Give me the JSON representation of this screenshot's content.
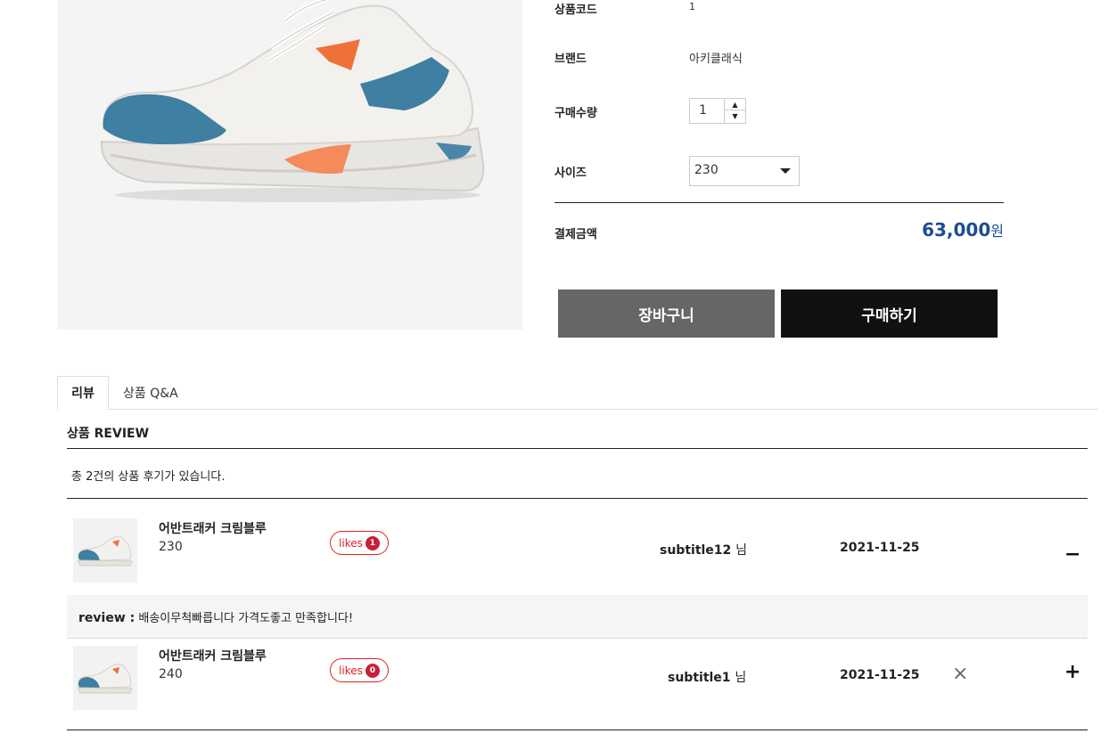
{
  "product": {
    "image_icon": "sneaker-image",
    "info": {
      "code_label": "상품코드",
      "code_value": "1",
      "brand_label": "브랜드",
      "brand_value": "아키클래식",
      "qty_label": "구매수량",
      "qty_value": "1",
      "size_label": "사이즈",
      "size_value": "230",
      "total_label": "결제금액",
      "total_value": "63,000",
      "total_unit": "원"
    },
    "buttons": {
      "cart": "장바구니",
      "buy": "구매하기"
    },
    "colors": {
      "price": "#1b4d92",
      "cart_button": "#666666",
      "buy_button": "#111111",
      "likes_accent": "#c8203a"
    }
  },
  "tabs": [
    {
      "label": "리뷰",
      "active": true
    },
    {
      "label": "상품 Q&A",
      "active": false
    }
  ],
  "reviews": {
    "heading": "상품 REVIEW",
    "count_text": "총 2건의 상품 후기가 있습니다.",
    "likes_label": "likes",
    "honorific": "님",
    "items": [
      {
        "name": "어반트래커 크림블루",
        "size": "230",
        "likes": "1",
        "author": "subtitle12",
        "date": "2021-11-25",
        "toggle": "−",
        "expanded": true,
        "review_label": "review :",
        "review_text": "배송이무척빠릅니다 가격도좋고 만족합니다!"
      },
      {
        "name": "어반트래커 크림블루",
        "size": "240",
        "likes": "0",
        "author": "subtitle1",
        "date": "2021-11-25",
        "toggle": "+",
        "delete_icon": "×",
        "expanded": false
      }
    ]
  }
}
